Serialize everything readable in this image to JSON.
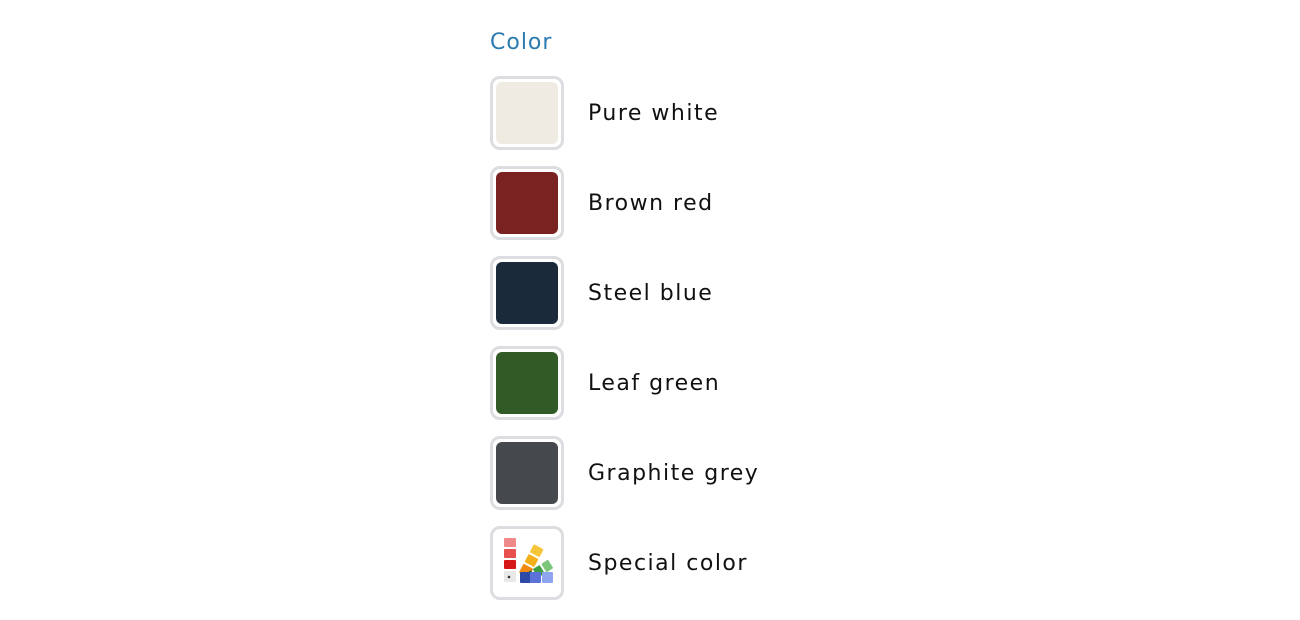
{
  "section": {
    "label": "Color"
  },
  "options": [
    {
      "label": "Pure white",
      "color": "#efebe3"
    },
    {
      "label": "Brown red",
      "color": "#7a2221"
    },
    {
      "label": "Steel blue",
      "color": "#1b2a3b"
    },
    {
      "label": "Leaf green",
      "color": "#315a27"
    },
    {
      "label": "Graphite grey",
      "color": "#45484c"
    },
    {
      "label": "Special color",
      "icon": "color-fan-deck-icon"
    }
  ]
}
